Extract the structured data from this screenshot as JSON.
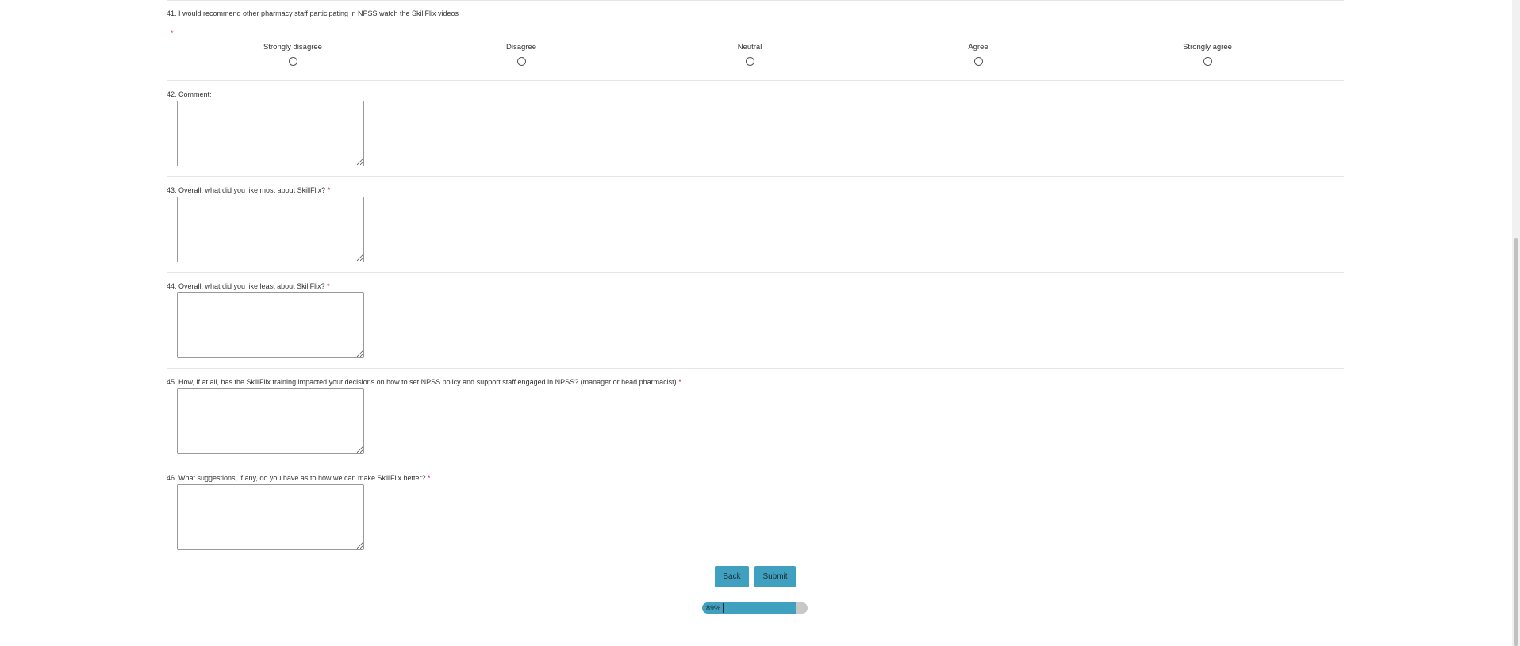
{
  "survey": {
    "q41": {
      "label": "41. I would recommend other pharmacy staff participating in NPSS watch the SkillFlix videos",
      "required_mark": "*",
      "options": [
        "Strongly disagree",
        "Disagree",
        "Neutral",
        "Agree",
        "Strongly agree"
      ]
    },
    "q42": {
      "label": "42. Comment:",
      "value": ""
    },
    "q43": {
      "label": "43. Overall, what did you like most about SkillFlix?",
      "required_mark": "*",
      "value": ""
    },
    "q44": {
      "label": "44. Overall, what did you like least about SkillFlix?",
      "required_mark": "*",
      "value": ""
    },
    "q45": {
      "label": "45. How, if at all, has the SkillFlix training impacted your decisions on how to set NPSS policy and support staff engaged in NPSS? (manager or head pharmacist)",
      "required_mark": "*",
      "value": ""
    },
    "q46": {
      "label": "46. What suggestions, if any, do you have as to how we can make SkillFlix better?",
      "required_mark": "*",
      "value": ""
    }
  },
  "nav": {
    "back_label": "Back",
    "submit_label": "Submit"
  },
  "progress": {
    "percent": 89,
    "text": "89%"
  },
  "colors": {
    "accent": "#3fa0c0",
    "required": "#d0021b",
    "divider": "#e6e6e6"
  }
}
